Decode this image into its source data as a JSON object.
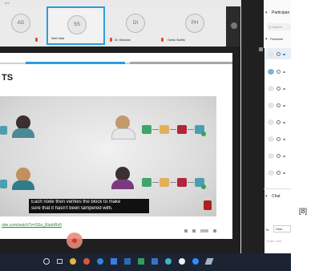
{
  "topbar": {
    "label": "ere"
  },
  "video_strip": {
    "tiles": [
      {
        "initials": "AG",
        "label": "lai"
      },
      {
        "initials": "SS",
        "label": "Sahil Jaba"
      },
      {
        "initials": "DI",
        "label": "Dr. Ghanvan"
      },
      {
        "initials": "PH",
        "label": "Gamic Sudhik"
      }
    ]
  },
  "presentation": {
    "slide_title": "TS",
    "caption_line1": "Each node then verifies the block to make",
    "caption_line2": "sure that it hasn't been tampered with.",
    "link_text": "obe.com/watch?v=SSo_EbahRo0"
  },
  "participants_panel": {
    "title": "Participan",
    "search_placeholder": "Q Search",
    "section_label": "Panelists",
    "chat_title": "Chat",
    "to_label": "To:",
    "to_value": "Host",
    "message_placeholder": "Enter chat"
  },
  "footnote": "[8]",
  "colors": {
    "accent": "#2d9cdb",
    "dark_bar": "#1f1f1f",
    "caption_bg": "#111111",
    "taskbar": "#1c2333"
  }
}
